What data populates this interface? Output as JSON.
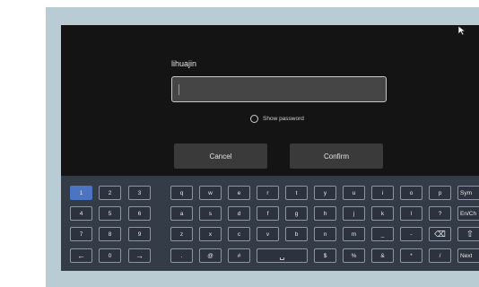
{
  "dialog": {
    "username": "lihuajin",
    "password_value": "",
    "show_password_label": "Show password",
    "cancel_label": "Cancel",
    "confirm_label": "Confirm"
  },
  "keyboard": {
    "numpad_rows": [
      [
        "1",
        "2",
        "3"
      ],
      [
        "4",
        "5",
        "6"
      ],
      [
        "7",
        "8",
        "9"
      ],
      [
        "←",
        "0",
        "→"
      ]
    ],
    "letter_rows": [
      [
        "q",
        "w",
        "e",
        "r",
        "t",
        "y",
        "u",
        "i",
        "o",
        "p"
      ],
      [
        "a",
        "s",
        "d",
        "f",
        "g",
        "h",
        "j",
        "k",
        "l",
        "?"
      ],
      [
        "z",
        "x",
        "c",
        "v",
        "b",
        "n",
        "m",
        "_",
        "-",
        "⌫"
      ],
      [
        ".",
        "@",
        "#",
        "␣",
        "$",
        "%",
        "&",
        "*",
        "/"
      ]
    ],
    "function_keys": [
      "Sym",
      "En/Ch",
      "⇧",
      "Next"
    ],
    "active_key": "1",
    "colors": {
      "active_key": "#4b75c3",
      "keyboard_bg": "#343c48",
      "screen_bg": "#141414"
    }
  }
}
